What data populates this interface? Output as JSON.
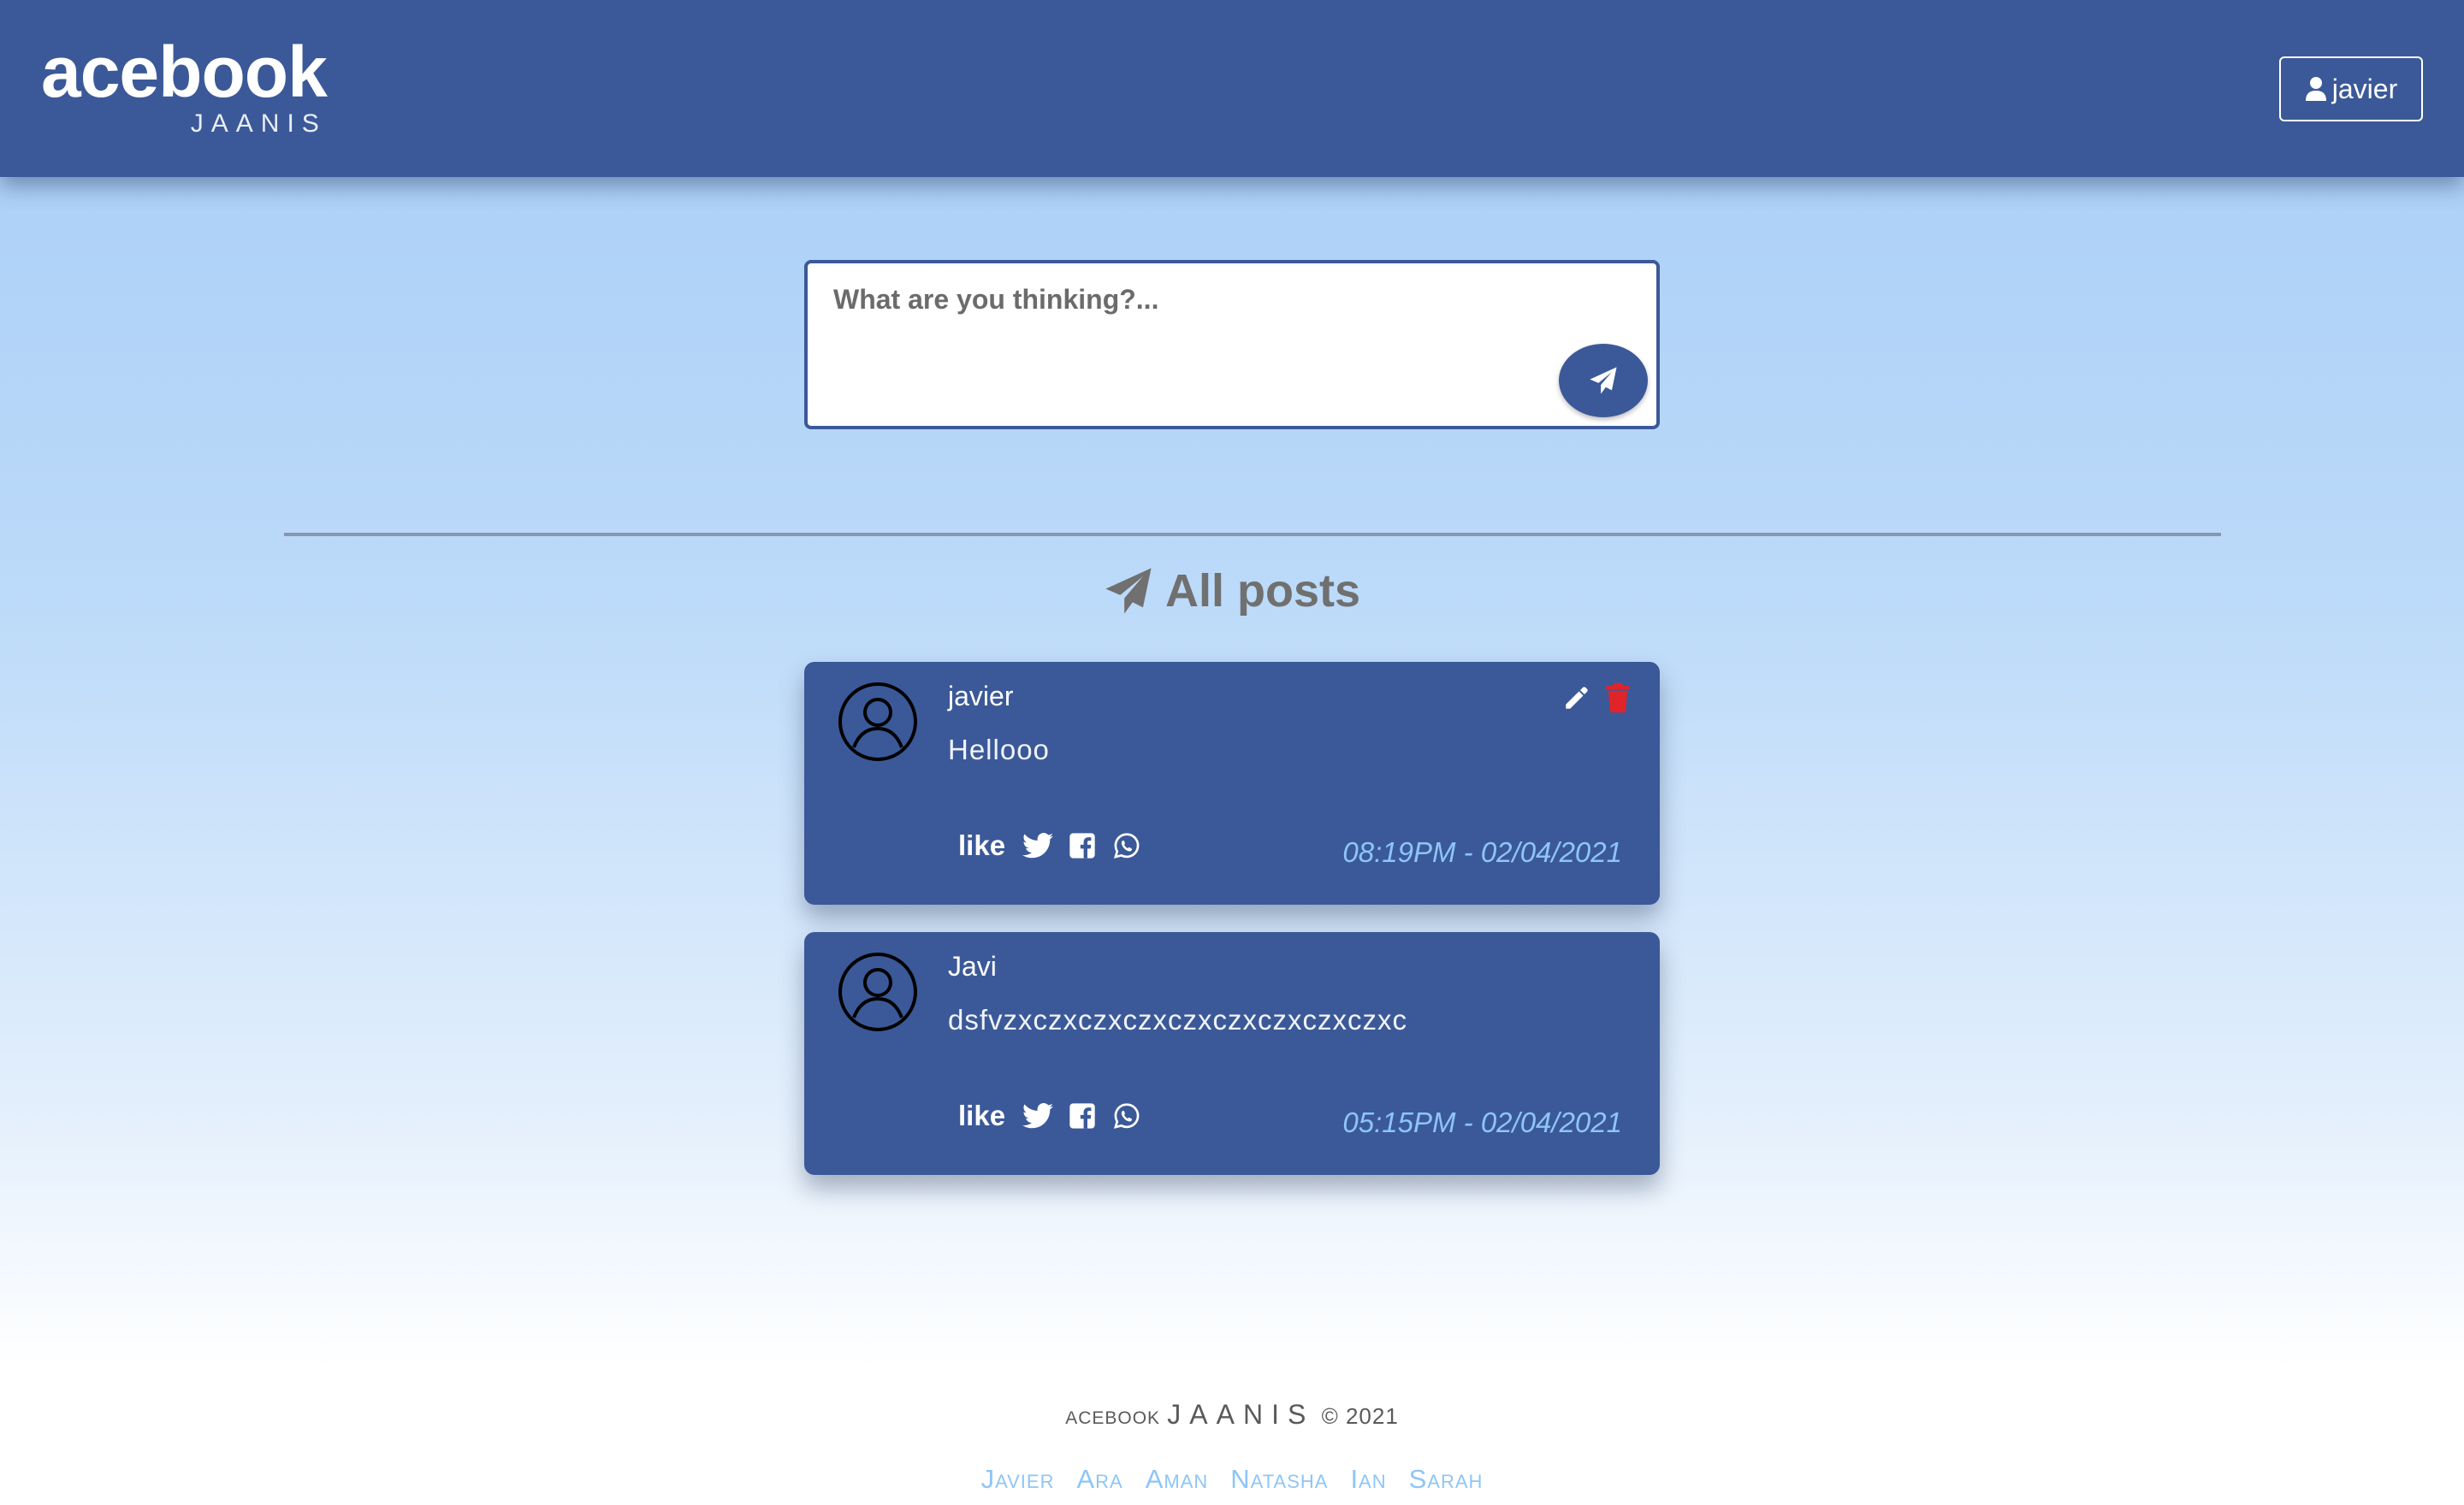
{
  "header": {
    "brand": "acebook",
    "sub_brand": "JAANIS",
    "user_button_label": "javier"
  },
  "composer": {
    "placeholder": "What are you thinking?...",
    "value": ""
  },
  "feed": {
    "title": "All posts",
    "posts": [
      {
        "author": "javier",
        "body": "Hellooo",
        "like_label": "like",
        "timestamp": "08:19PM - 02/04/2021",
        "editable": true
      },
      {
        "author": "Javi",
        "body": "dsfvzxczxczxczxczxczxczxczxczxc",
        "like_label": "like",
        "timestamp": "05:15PM - 02/04/2021",
        "editable": false
      }
    ]
  },
  "footer": {
    "brand": "ACEBOOK",
    "sub_brand": "JAANIS",
    "copyright": "© 2021",
    "team": [
      "Javier",
      "Ara",
      "Aman",
      "Natasha",
      "Ian",
      "Sarah"
    ]
  },
  "colors": {
    "primary": "#3b5998",
    "accent_text": "#8ec5f7",
    "delete": "#e0242a"
  }
}
